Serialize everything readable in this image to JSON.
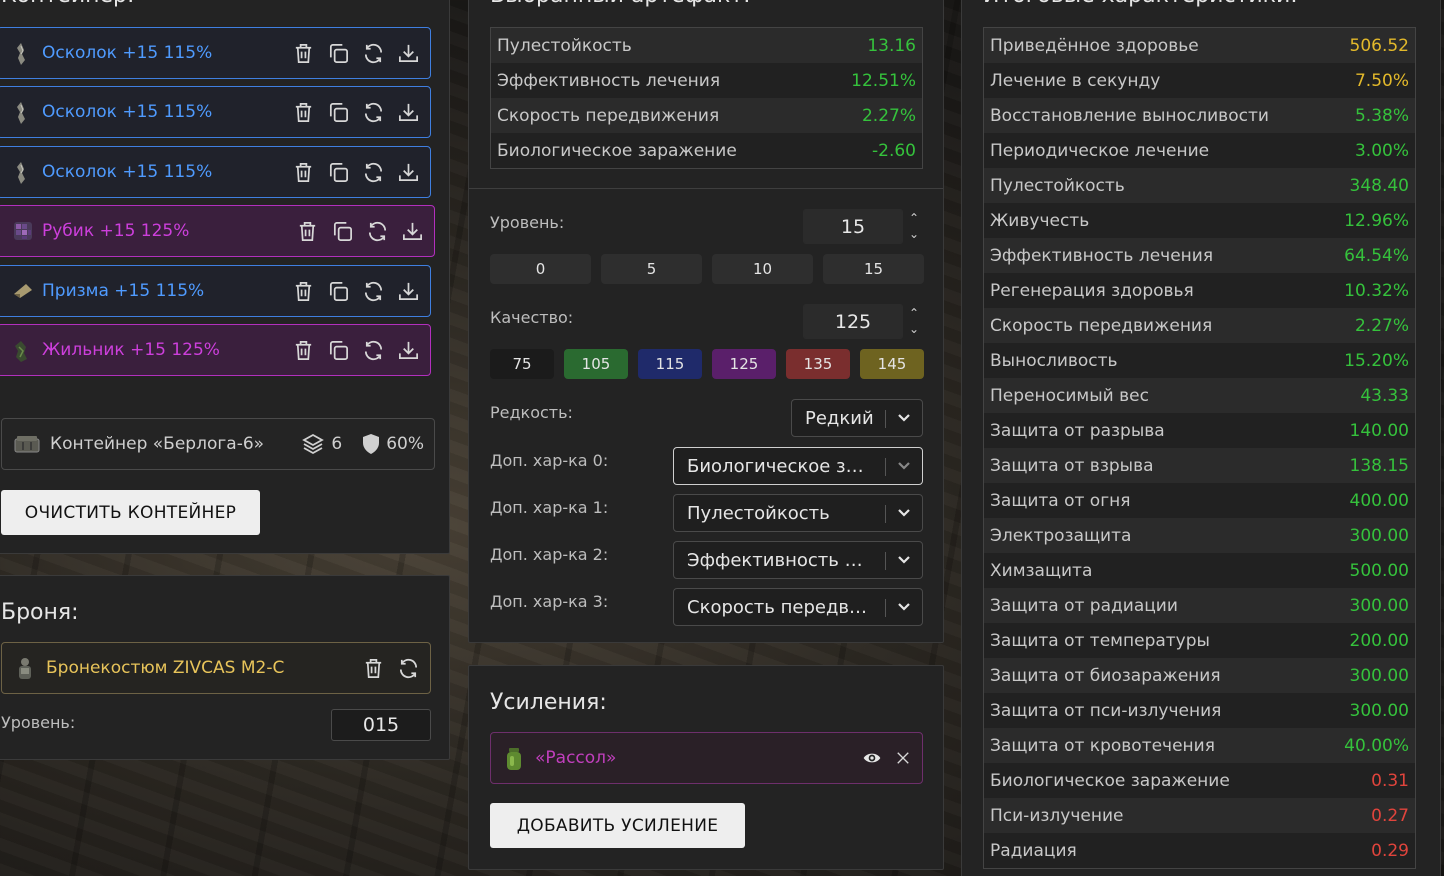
{
  "container_panel": {
    "title": "Контейнер:",
    "slots": [
      {
        "name": "Осколок +15 115%",
        "rarity": "blue"
      },
      {
        "name": "Осколок +15 115%",
        "rarity": "blue"
      },
      {
        "name": "Осколок +15 115%",
        "rarity": "blue"
      },
      {
        "name": "Рубик +15 125%",
        "rarity": "purple"
      },
      {
        "name": "Призма +15 115%",
        "rarity": "blue"
      },
      {
        "name": "Жильник +15 125%",
        "rarity": "purple"
      }
    ],
    "container_name": "Контейнер «Берлога-6»",
    "capacity": "6",
    "protection": "60%",
    "clear_button": "ОЧИСТИТЬ КОНТЕЙНЕР"
  },
  "armor_panel": {
    "title": "Броня:",
    "armor_name": "Бронекостюм ZIVCAS M2-C",
    "level_label": "Уровень:",
    "level_value": "015"
  },
  "artifact_panel": {
    "title": "Выбранный артефакт:",
    "stats": [
      {
        "name": "Пулестойкость",
        "value": "13.16",
        "color": "green"
      },
      {
        "name": "Эффективность лечения",
        "value": "12.51%",
        "color": "green"
      },
      {
        "name": "Скорость передвижения",
        "value": "2.27%",
        "color": "green"
      },
      {
        "name": "Биологическое заражение",
        "value": "-2.60",
        "color": "green"
      }
    ],
    "level_label": "Уровень:",
    "level_value": "15",
    "level_presets": [
      "0",
      "5",
      "10",
      "15"
    ],
    "quality_label": "Качество:",
    "quality_value": "125",
    "quality_presets": [
      {
        "label": "75",
        "color": "#1b1b1b"
      },
      {
        "label": "105",
        "color": "#2a6a30"
      },
      {
        "label": "115",
        "color": "#1f2a6a"
      },
      {
        "label": "125",
        "color": "#5a1f6a"
      },
      {
        "label": "135",
        "color": "#7a2e2e"
      },
      {
        "label": "145",
        "color": "#6e6320"
      }
    ],
    "rarity_label": "Редкость:",
    "rarity_value": "Редкий",
    "extra_stats": [
      {
        "label": "Доп. хар-ка 0:",
        "value": "Биологическое за..."
      },
      {
        "label": "Доп. хар-ка 1:",
        "value": "Пулестойкость"
      },
      {
        "label": "Доп. хар-ка 2:",
        "value": "Эффективность ле..."
      },
      {
        "label": "Доп. хар-ка 3:",
        "value": "Скорость передви..."
      }
    ]
  },
  "boosts_panel": {
    "title": "Усиления:",
    "boost_name": "«Рассол»",
    "add_button": "ДОБАВИТЬ УСИЛЕНИЕ"
  },
  "totals_panel": {
    "title": "Итоговые характеристики:",
    "stats": [
      {
        "name": "Приведённое здоровье",
        "value": "506.52",
        "color": "yellow"
      },
      {
        "name": "Лечение в секунду",
        "value": "7.50%",
        "color": "yellow"
      },
      {
        "name": "Восстановление выносливости",
        "value": "5.38%",
        "color": "green"
      },
      {
        "name": "Периодическое лечение",
        "value": "3.00%",
        "color": "green"
      },
      {
        "name": "Пулестойкость",
        "value": "348.40",
        "color": "green"
      },
      {
        "name": "Живучесть",
        "value": "12.96%",
        "color": "green"
      },
      {
        "name": "Эффективность лечения",
        "value": "64.54%",
        "color": "green"
      },
      {
        "name": "Регенерация здоровья",
        "value": "10.32%",
        "color": "green"
      },
      {
        "name": "Скорость передвижения",
        "value": "2.27%",
        "color": "green"
      },
      {
        "name": "Выносливость",
        "value": "15.20%",
        "color": "green"
      },
      {
        "name": "Переносимый вес",
        "value": "43.33",
        "color": "green"
      },
      {
        "name": "Защита от разрыва",
        "value": "140.00",
        "color": "green"
      },
      {
        "name": "Защита от взрыва",
        "value": "138.15",
        "color": "green"
      },
      {
        "name": "Защита от огня",
        "value": "400.00",
        "color": "green"
      },
      {
        "name": "Электрозащита",
        "value": "300.00",
        "color": "green"
      },
      {
        "name": "Химзащита",
        "value": "500.00",
        "color": "green"
      },
      {
        "name": "Защита от радиации",
        "value": "300.00",
        "color": "green"
      },
      {
        "name": "Защита от температуры",
        "value": "200.00",
        "color": "green"
      },
      {
        "name": "Защита от биозаражения",
        "value": "300.00",
        "color": "green"
      },
      {
        "name": "Защита от пси-излучения",
        "value": "300.00",
        "color": "green"
      },
      {
        "name": "Защита от кровотечения",
        "value": "40.00%",
        "color": "green"
      },
      {
        "name": "Биологическое заражение",
        "value": "0.31",
        "color": "red"
      },
      {
        "name": "Пси-излучение",
        "value": "0.27",
        "color": "red"
      },
      {
        "name": "Радиация",
        "value": "0.29",
        "color": "red"
      }
    ]
  }
}
